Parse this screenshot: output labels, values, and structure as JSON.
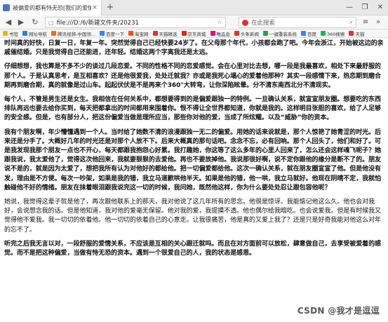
{
  "browser": {
    "tab_title": "被偏爱的都有恃无恐[我们的爱情故事]",
    "tab_close": "×",
    "new_tab": "+",
    "url": "file:///D:/6/新建文件夹/20231",
    "search_placeholder": "在此搜索",
    "window_controls": [
      "—",
      "❐",
      "✕"
    ]
  },
  "bookmarks": [
    {
      "label": "书签",
      "color": "#f0b400"
    },
    {
      "label": "网址导航",
      "color": "#2f7de1"
    },
    {
      "label": "腾讯视频-中国领...",
      "color": "#ff6a00"
    },
    {
      "label": "百度一下",
      "color": "#3385ff"
    },
    {
      "label": "淘宝网",
      "color": "#ff5000"
    },
    {
      "label": "天猫精选",
      "color": "#e0322d"
    },
    {
      "label": "京东商城",
      "color": "#e1251b"
    },
    {
      "label": "唯品会",
      "color": "#f10180"
    },
    {
      "label": "头条新闻",
      "color": "#e0322d"
    },
    {
      "label": "一键重装系统",
      "color": "#2aa04a"
    },
    {
      "label": "百度",
      "color": "#3385ff"
    },
    {
      "label": "360搜索",
      "color": "#19b955"
    },
    {
      "label": "天猫",
      "color": "#e0322d"
    }
  ],
  "article": {
    "paragraphs": [
      {
        "bold": true,
        "text": "时间真的好快，日复一日，年复一年。突然觉得自己已经快要24岁了。在父母那个年代，小孩都会跑了吧。今年会浙江，开始被这边的亲戚催结婚。只是我觉得自己还能进，还年轻。结婚这两个字离我还是太远。"
      },
      {
        "bold": true,
        "text": "仔细想想，我也算是不多不少的谈过几段恋爱。不同的性格不同的恋爱感觉。会在心里对比去想，哪一段是我最喜欢，相处下来最舒服的那个人。于是认真思考，是互相喜欢？还是他很爱我，处处迁就我？亦或是我死心塌心的爱着他那种？其实一段感情下来，热恋期到磨合期再到磨合期，真的就像是过山车。起起伏伏是不是再来个360°大转弯，让你深陷眩晕。分不清东南西北分不清现实。"
      },
      {
        "bold": true,
        "text": "每个人，不管是男生还是女生。我相信在任何关系中，都想要得到的是偏爱跟独一的特例。一旦确认关系，就宣宣朋友圈。想要吃的东西排队再远也要去给你买到，每天把都拿出的时间都用来围着你。恨不得让全世界都知道，你就是我的。这样明目张胆的喜欢，给了人足够的安全感。但是，也有部分人，把这份偏爱当做是理所应当，那些你对他的爱，当成了所炫耀。以及“威胁”你的资本。"
      },
      {
        "bold": true,
        "text": "我有个朋友啊，年少懵懂遇到一个人。当时给了她数不清的浪漫跟独一无二的偏爱。用她的话来说就是，那个人惊艳了她青涩的时光。后来还是分手了。大概好几年的时光还是对那个人放不下。后来大概真的那句话吧。念念不忘，必有回响。那个人回头了，他们和好了。可是我发现我那个朋友一点也不开心，每天都跟我抱怨心好累。我打趣她，你这等了这么多年的心里人回来了，怎么还会这样魂飞呢子？她跟我说，我太爱他了，觉得这次他回来，我就要狠狠的去爱他。再也不要放掉他。我说那很好啊，说不定你跟他的缘分是断不了的。朋友说不是的，就是因为太爱了，想把我所有认为对他好的都给他。把一切偏爱都给他。这次一确认关系，就在朋友圈宣宣了他。但是他没有发，理由是不方便。每次一吵架，如果是我的错，我立马道歉哄他半天。如果是他的错，他一哄，我立马就好。他现在阴晴不定，我就怕触碰他不好的情绪。朋友在抹着眼泪跟我说完这一切的时候，我问她，既然他这样，你为什么要处处忍让跟包容他呢？"
      },
      {
        "bold": false,
        "text": "她说，我觉得这辈子就是他了，再次跟他联系上的那天，我对他说了这几年所有的思念。他很是惊讶。我能惦记他这么久。他也会对我好，会说想念我的话。但是他知道，我对他的爱毫无保留。他对我的爱，我提摸不透。他也偶尔给我暗吃。也会说爱我。但是有时候我又觉得他不爱我。我一切切的依着他。他一切切的依着自己的心意走。让我很痛苦，他是真的又爱上我了？还是只是好奇我能对他这么对年的忘不了。"
      },
      {
        "bold": true,
        "text": "听完之后我无言以对，一段舒服的爱情关系，不应该是互相的关心跟迁就吗。而且在对方面前可以放松，肆意做自己，去享受被爱着的感觉。而不是把这种偏爱，当做有恃无恐的资本。遇到一个很爱自己的人，我的状态是感恩。"
      }
    ]
  },
  "watermark": "CSDN @我才是逗逗"
}
